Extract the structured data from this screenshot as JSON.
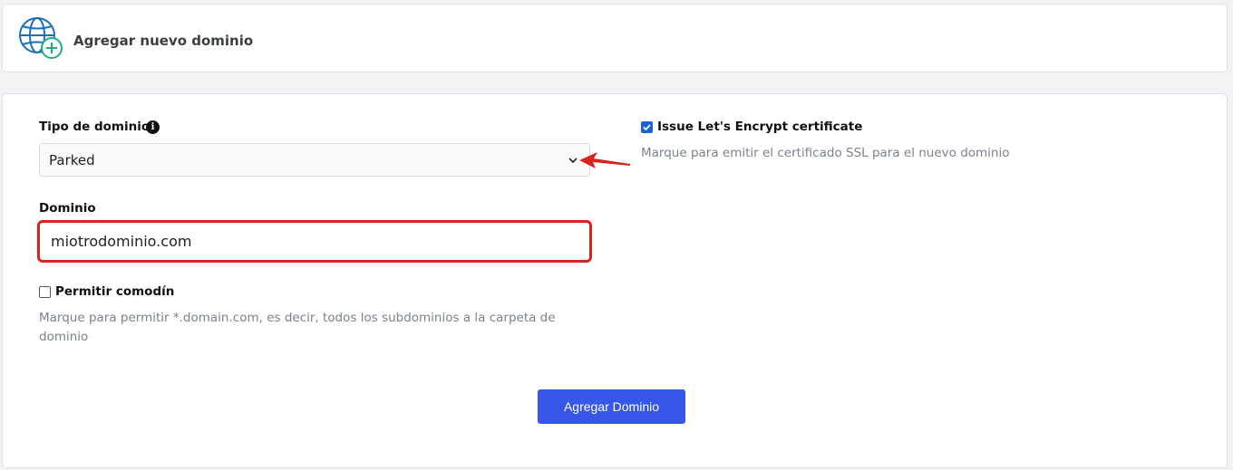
{
  "header": {
    "title": "Agregar nuevo dominio",
    "icon": "globe-add-icon"
  },
  "form": {
    "domain_type": {
      "label": "Tipo de dominio",
      "info_icon": "info-icon",
      "value": "Parked"
    },
    "domain": {
      "label": "Dominio",
      "value": "miotrodominio.com"
    },
    "wildcard": {
      "label": "Permitir comodín",
      "checked": false,
      "help": "Marque para permitir *.domain.com, es decir, todos los subdominios a la carpeta de dominio"
    },
    "ssl": {
      "label": "Issue Let's Encrypt certificate",
      "checked": true,
      "help": "Marque para emitir el certificado SSL para el nuevo dominio"
    },
    "submit_label": "Agregar Dominio"
  },
  "colors": {
    "primary_button": "#3757e8",
    "highlight_border": "#d8231f",
    "checkbox_checked": "#1a63d8",
    "icon_blue": "#1f6fb8",
    "icon_green": "#1fae7a"
  }
}
